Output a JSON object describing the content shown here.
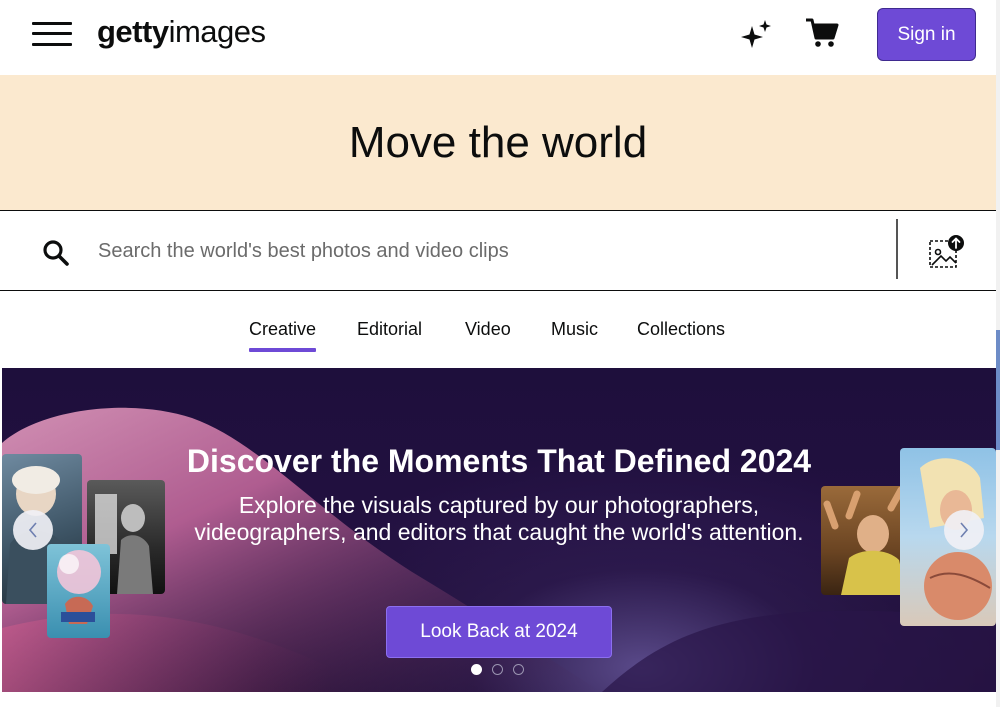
{
  "header": {
    "logo_bold": "getty",
    "logo_light": "images",
    "sign_in_label": "Sign in",
    "icons": [
      "menu-icon",
      "sparkle-icon",
      "cart-icon"
    ]
  },
  "hero": {
    "title": "Move the world"
  },
  "search": {
    "placeholder": "Search the world's best photos and video clips",
    "icons": [
      "search-icon",
      "image-search-icon"
    ]
  },
  "tabs": [
    {
      "label": "Creative",
      "active": true
    },
    {
      "label": "Editorial",
      "active": false
    },
    {
      "label": "Video",
      "active": false
    },
    {
      "label": "Music",
      "active": false
    },
    {
      "label": "Collections",
      "active": false
    }
  ],
  "promo": {
    "heading": "Discover the Moments That Defined 2024",
    "subtext_line1": "Explore the visuals captured by our photographers,",
    "subtext_line2": "videographers, and editors that caught the world's attention.",
    "cta_label": "Look Back at 2024",
    "slides_total": 3,
    "active_slide": 1,
    "arrows": [
      "chevron-left-icon",
      "chevron-right-icon"
    ]
  },
  "colors": {
    "accent": "#6e4ad6",
    "hero_band": "#fbe9cf",
    "promo_bg": "#1e0f3c",
    "text": "#0c0d0d"
  }
}
